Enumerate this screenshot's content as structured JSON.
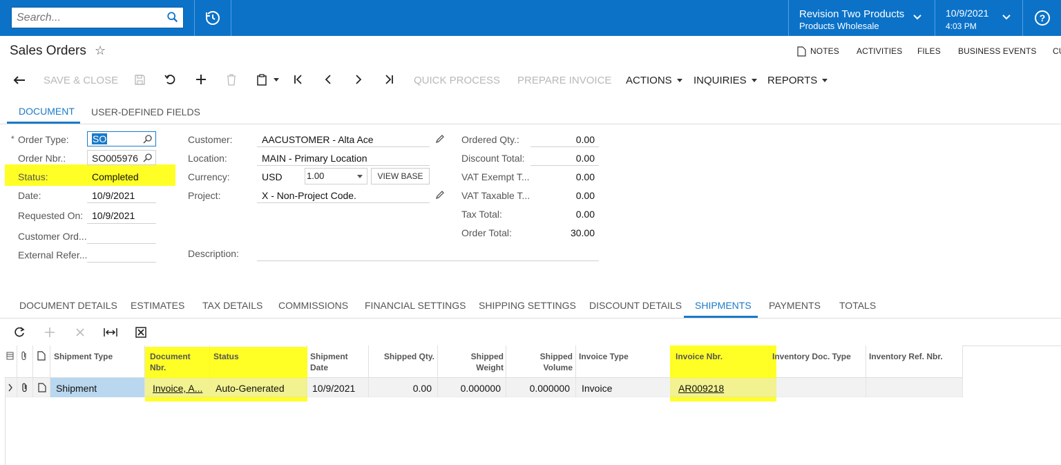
{
  "topbar": {
    "search_placeholder": "Search...",
    "company_name": "Revision Two Products",
    "company_branch": "Products Wholesale",
    "date": "10/9/2021",
    "time": "4:03 PM",
    "color": "#0b72c8"
  },
  "header": {
    "title": "Sales Orders",
    "links": [
      "NOTES",
      "ACTIVITIES",
      "FILES",
      "BUSINESS EVENTS",
      "CU"
    ]
  },
  "toolbar": {
    "save_close": "SAVE & CLOSE",
    "quick_process": "QUICK PROCESS",
    "prepare_invoice": "PREPARE INVOICE",
    "actions": "ACTIONS",
    "inquiries": "INQUIRIES",
    "reports": "REPORTS"
  },
  "top_tabs": [
    "DOCUMENT",
    "USER-DEFINED FIELDS"
  ],
  "form": {
    "required_mark": "*",
    "order_type_label": "Order Type:",
    "order_type": "SO",
    "order_nbr_label": "Order Nbr.:",
    "order_nbr": "SO005976",
    "status_label": "Status:",
    "status": "Completed",
    "date_label": "Date:",
    "date": "10/9/2021",
    "requested_on_label": "Requested On:",
    "requested_on": "10/9/2021",
    "customer_ord_label": "Customer Ord...",
    "external_ref_label": "External Refer...",
    "customer_label": "Customer:",
    "customer": "AACUSTOMER - Alta Ace",
    "location_label": "Location:",
    "location": "MAIN - Primary Location",
    "currency_label": "Currency:",
    "currency": "USD",
    "currency_rate": "1.00",
    "view_base": "VIEW BASE",
    "project_label": "Project:",
    "project": "X - Non-Project Code.",
    "description_label": "Description:",
    "ordered_qty_label": "Ordered Qty.:",
    "ordered_qty": "0.00",
    "discount_total_label": "Discount Total:",
    "discount_total": "0.00",
    "vat_exempt_label": "VAT Exempt T...",
    "vat_exempt": "0.00",
    "vat_taxable_label": "VAT Taxable T...",
    "vat_taxable": "0.00",
    "tax_total_label": "Tax Total:",
    "tax_total": "0.00",
    "order_total_label": "Order Total:",
    "order_total": "30.00"
  },
  "detail_tabs": [
    "DOCUMENT DETAILS",
    "ESTIMATES",
    "TAX DETAILS",
    "COMMISSIONS",
    "FINANCIAL SETTINGS",
    "SHIPPING SETTINGS",
    "DISCOUNT DETAILS",
    "SHIPMENTS",
    "PAYMENTS",
    "TOTALS"
  ],
  "grid": {
    "headers": {
      "shipment_type": "Shipment Type",
      "document_nbr_1": "Document",
      "document_nbr_2": "Nbr.",
      "status": "Status",
      "shipment_date_1": "Shipment",
      "shipment_date_2": "Date",
      "shipped_qty": "Shipped Qty.",
      "shipped_weight_1": "Shipped",
      "shipped_weight_2": "Weight",
      "shipped_volume_1": "Shipped",
      "shipped_volume_2": "Volume",
      "invoice_type": "Invoice Type",
      "invoice_nbr": "Invoice Nbr.",
      "inventory_doc_type": "Inventory Doc. Type",
      "inventory_ref_nbr": "Inventory Ref. Nbr."
    },
    "rows": [
      {
        "shipment_type": "Shipment",
        "document_nbr": "Invoice, A...",
        "status": "Auto-Generated",
        "shipment_date": "10/9/2021",
        "shipped_qty": "0.00",
        "shipped_weight": "0.000000",
        "shipped_volume": "0.000000",
        "invoice_type": "Invoice",
        "invoice_nbr": "AR009218"
      }
    ]
  },
  "highlight_color": "#ffff00"
}
